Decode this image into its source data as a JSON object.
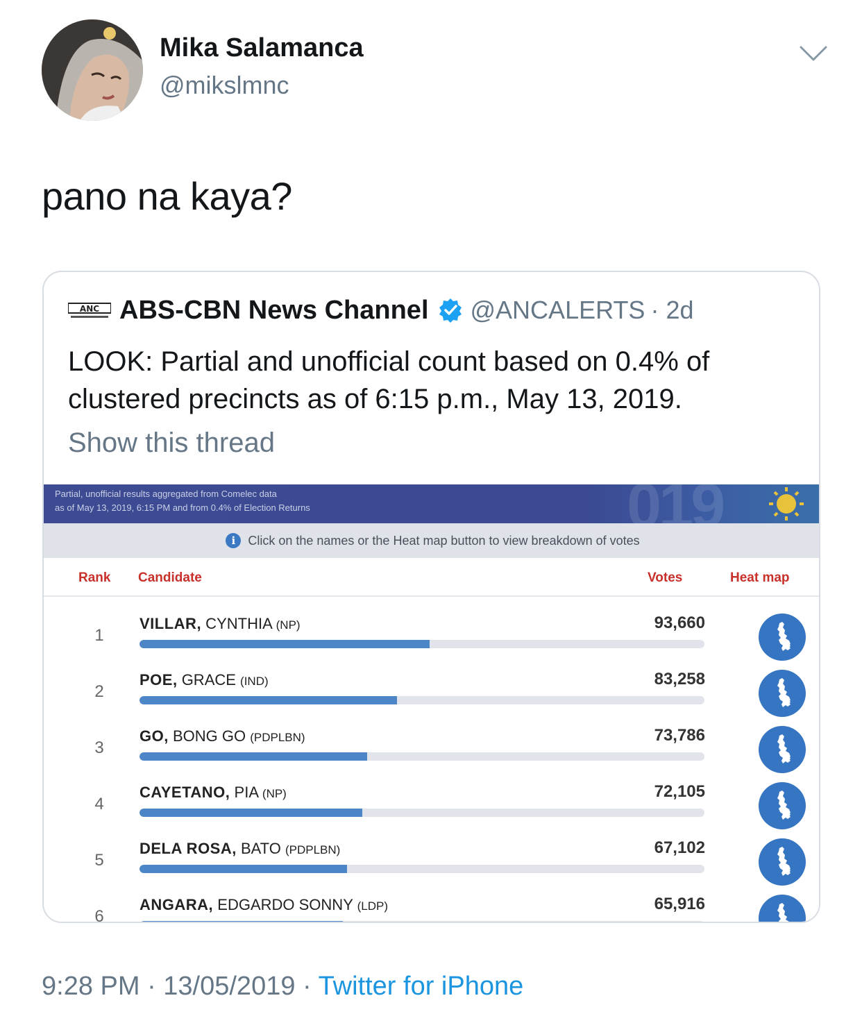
{
  "author": {
    "name": "Mika Salamanca",
    "handle": "@mikslmnc"
  },
  "tweet_text": "pano na kaya?",
  "quoted": {
    "name": "ABS-CBN News Channel",
    "handle": "@ANCALERTS",
    "time": "· 2d",
    "body": "LOOK: Partial and unofficial count based on 0.4% of clustered precincts as of 6:15  p.m., May 13, 2019.",
    "show_thread": "Show this thread",
    "logo_text": "ANC",
    "embed": {
      "banner_line1": "Partial, unofficial results aggregated from Comelec data",
      "banner_line2": "as of May 13, 2019, 6:15 PM and from 0.4% of Election Returns",
      "banner_deco": "019",
      "info": "Click on the names or the Heat map button to view breakdown of votes",
      "columns": {
        "rank": "Rank",
        "candidate": "Candidate",
        "votes": "Votes",
        "heatmap": "Heat map"
      },
      "rows": [
        {
          "rank": "1",
          "last": "VILLAR,",
          "first": "CYNTHIA",
          "party": "(NP)",
          "votes": "93,660",
          "share": 0.513
        },
        {
          "rank": "2",
          "last": "POE,",
          "first": "GRACE",
          "party": "(IND)",
          "votes": "83,258",
          "share": 0.456
        },
        {
          "rank": "3",
          "last": "GO,",
          "first": "BONG GO",
          "party": "(PDPLBN)",
          "votes": "73,786",
          "share": 0.403
        },
        {
          "rank": "4",
          "last": "CAYETANO,",
          "first": "PIA",
          "party": "(NP)",
          "votes": "72,105",
          "share": 0.394
        },
        {
          "rank": "5",
          "last": "DELA ROSA,",
          "first": "BATO",
          "party": "(PDPLBN)",
          "votes": "67,102",
          "share": 0.367
        },
        {
          "rank": "6",
          "last": "ANGARA,",
          "first": "EDGARDO SONNY",
          "party": "(LDP)",
          "votes": "65,916",
          "share": 0.36
        }
      ]
    }
  },
  "footer": {
    "time": "9:28 PM · 13/05/2019 · ",
    "source": "Twitter for iPhone"
  },
  "icons": {
    "chevron": "chevron-down-icon",
    "verified": "verified-badge-icon",
    "info": "info-icon",
    "heatmap": "philippines-map-icon"
  },
  "colors": {
    "link": "#1b95e0",
    "muted": "#657786",
    "bar": "#4d86c6",
    "heat": "#3675c1",
    "header_red": "#c8312b"
  }
}
